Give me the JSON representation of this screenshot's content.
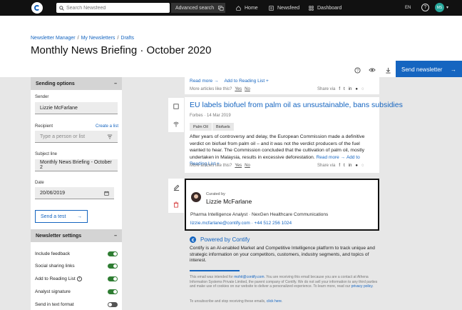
{
  "topbar": {
    "search_placeholder": "Search Newsfeed",
    "advanced_search": "Advanced search",
    "nav": [
      {
        "label": "Home"
      },
      {
        "label": "Newsfeed"
      },
      {
        "label": "Dashboard"
      }
    ],
    "lang": "EN",
    "help": "?",
    "avatar_initials": "MS"
  },
  "breadcrumb": [
    "Newsletter Manager",
    "My Newsletters",
    "Drafts"
  ],
  "page_title": "Monthly News Briefing · October 2020",
  "toolbar": {
    "send_label": "Send newsletter"
  },
  "sending_options": {
    "header": "Sending options",
    "sender_label": "Sender",
    "sender_value": "Lizzie McFarlane",
    "recipient_label": "Recipient",
    "create_list": "Create a list",
    "recipient_placeholder": "Type a person or list",
    "subject_label": "Subject line",
    "subject_value": "Monthly News Briefing - October 2",
    "date_label": "Date",
    "date_value": "20/06/2019",
    "send_test": "Send a test"
  },
  "newsletter_settings": {
    "header": "Newsletter settings",
    "items": [
      {
        "label": "Include feedback",
        "on": true
      },
      {
        "label": "Social sharing links",
        "on": true
      },
      {
        "label": "Add to Reading List",
        "on": true,
        "info": true
      },
      {
        "label": "Analyst signature",
        "on": true
      },
      {
        "label": "Send in text format",
        "on": false
      }
    ]
  },
  "prev_card": {
    "read_more": "Read more →",
    "add_reading": "Add to Reading List +",
    "more_like": "More articles like this?",
    "yes": "Yes",
    "no": "No",
    "share_via": "Share via"
  },
  "article": {
    "title": "EU labels biofuel from palm oil as unsustainable, bans subsidies",
    "source": "Forbes · 14 Mar 2019",
    "tags": [
      "Palm Oil",
      "Biofuels"
    ],
    "body": "After years of controversy and delay, the European Commission made a definitive verdict on biofuel from palm oil – and it was not the verdict producers of the fuel wanted to hear. The Commission concluded that the cultivation of palm oil, mostly undertaken in Malaysia, results in excessive deforestation.",
    "read_more": "Read more →",
    "add_reading": "Add to Reading List +",
    "more_like": "More articles like this?",
    "yes": "Yes",
    "no": "No",
    "share_via": "Share via"
  },
  "curated": {
    "label": "Curated by",
    "name": "Lizzie McFarlane",
    "role": "Pharma Intelligence Analyst · NexGen Healthcare Communications",
    "contact": "lizzie.mcfarlane@contify.com · +44 512 256 1024"
  },
  "footer": {
    "powered": "Powered by Contify",
    "description": "Contify is an AI-enabled Market and Competitive Intelligence platform to track unique and strategic information on your competitors, customers, industry segments, and topics of interest.",
    "fine_1": "This email was intended for ",
    "fine_email": "mohit@contify.com",
    "fine_2": ". You are receiving this email because you are a contact at Athena Information Systems Private Limited, the parent company of Contify. We do not sell your information to any third parties and make use of cookies on our website to deliver a personalized experience. To learn more, read our ",
    "fine_policy": "privacy policy",
    "fine_3": ".",
    "unsub_1": "To unsubscribe and stop receiving these emails, ",
    "unsub_link": "click here",
    "unsub_2": "."
  },
  "colors": {
    "accent": "#1565c0",
    "topbar": "#111111",
    "toggle_on": "#2e7d32"
  }
}
